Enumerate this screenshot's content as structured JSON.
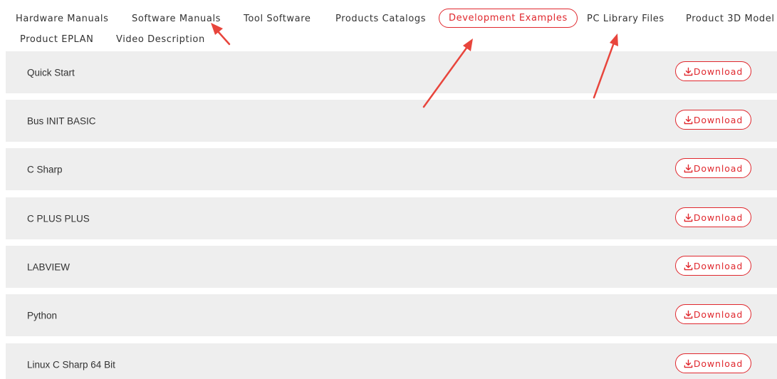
{
  "tabs": [
    {
      "label": "Hardware Manuals",
      "active": false
    },
    {
      "label": "Software Manuals",
      "active": false
    },
    {
      "label": "Tool Software",
      "active": false
    },
    {
      "label": "Products Catalogs",
      "active": false
    },
    {
      "label": "Development Examples",
      "active": true
    },
    {
      "label": "PC Library Files",
      "active": false
    },
    {
      "label": "Product 3D Model",
      "active": false
    },
    {
      "label": "Product EPLAN",
      "active": false
    },
    {
      "label": "Video Description",
      "active": false
    }
  ],
  "rows": [
    {
      "name": "Quick Start",
      "button": "Download"
    },
    {
      "name": "Bus INIT BASIC",
      "button": "Download"
    },
    {
      "name": "C Sharp",
      "button": "Download"
    },
    {
      "name": "C PLUS PLUS",
      "button": "Download"
    },
    {
      "name": "LABVIEW",
      "button": "Download"
    },
    {
      "name": "Python",
      "button": "Download"
    },
    {
      "name": "Linux C Sharp 64 Bit",
      "button": "Download"
    }
  ],
  "colors": {
    "accent": "#e0282e",
    "row_bg": "#eeeeee",
    "text": "#333333",
    "annotation_arrow": "#e8453c"
  },
  "icons": {
    "download": "download-icon",
    "annotation": "red-arrow-icon"
  }
}
